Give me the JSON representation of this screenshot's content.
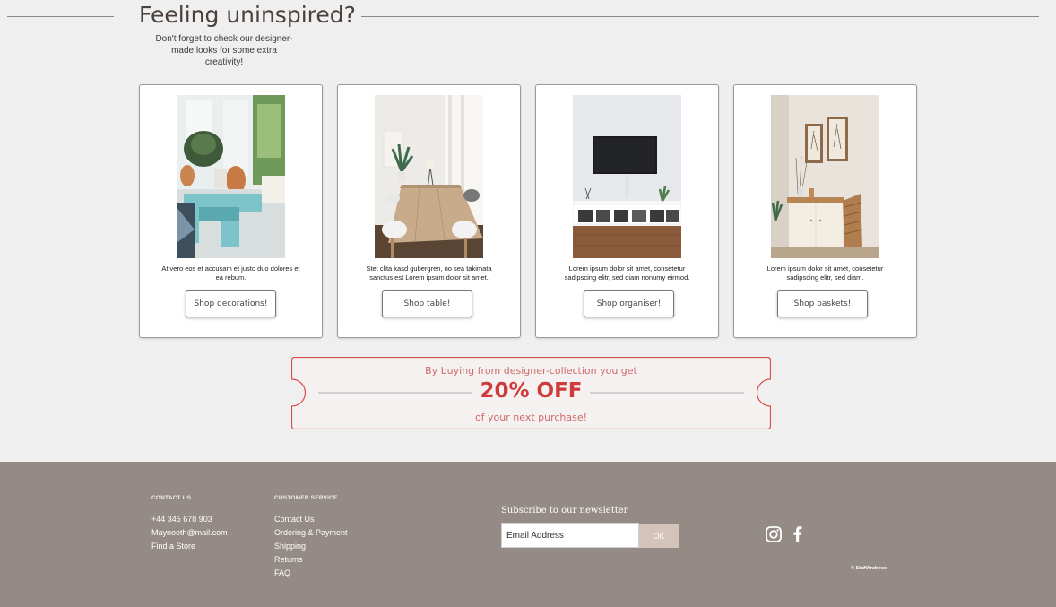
{
  "header": {
    "title": "Feeling uninspired?",
    "subtitle": "Don't forget to check our designer-made looks for some extra creativity!"
  },
  "cards": [
    {
      "text": "At vero eos et accusam et justo duo dolores et ea rebum.",
      "button": "Shop decorations!",
      "photo": "living-room-decorations"
    },
    {
      "text": "Stet clita kasd gubergren, no sea takimata sanctus est Lorem ipsum dolor sit amet.",
      "button": "Shop table!",
      "photo": "dining-table"
    },
    {
      "text": "Lorem ipsum dolor sit amet, consetetur sadipscing elitr, sed diam nonumy eirmod.",
      "button": "Shop organiser!",
      "photo": "tv-organiser"
    },
    {
      "text": "Lorem ipsum dolor sit amet, consetetur sadipscing elitr, sed diam.",
      "button": "Shop baskets!",
      "photo": "sideboard-baskets"
    }
  ],
  "coupon": {
    "line1": "By buying from designer-collection you get",
    "discount": "20% OFF",
    "line2": "of your next purchase!"
  },
  "footer": {
    "contact": {
      "heading": "CONTACT US",
      "phone": "+44 345 678 903",
      "email": "Maynooth@mail.com",
      "store": "Find a Store"
    },
    "service": {
      "heading": "CUSTOMER SERVICE",
      "items": [
        "Contact Us",
        "Ordering & Payment",
        "Shipping",
        "Returns",
        "FAQ"
      ]
    },
    "newsletter": {
      "title": "Subscribe to our newsletter",
      "placeholder": "Email Address",
      "button": "OK"
    },
    "social": [
      "instagram-icon",
      "facebook-icon"
    ],
    "copyright": "© StaffAndrews"
  },
  "colors": {
    "background": "#efefef",
    "footer": "#948b87",
    "coupon_accent": "#cf3b3b",
    "ok_button": "#d3c3b8"
  }
}
